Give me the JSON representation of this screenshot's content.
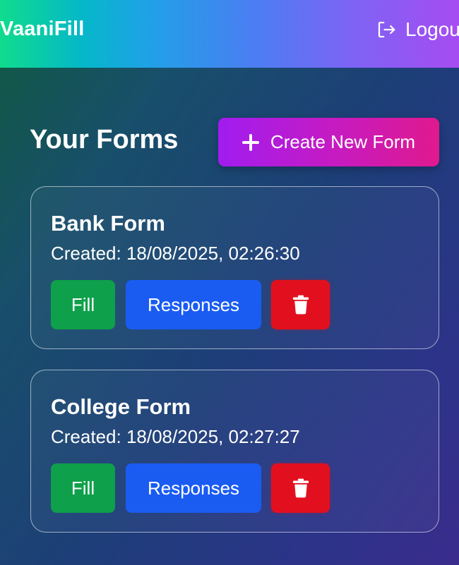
{
  "header": {
    "brand": "VaaniFill",
    "logout_label": "Logout",
    "logout_icon": "logout-icon"
  },
  "main": {
    "title": "Your Forms",
    "create_button": {
      "label": "Create New Form",
      "icon": "plus-icon"
    },
    "forms": [
      {
        "title": "Bank Form",
        "created": "Created: 18/08/2025, 02:26:30",
        "fill_label": "Fill",
        "responses_label": "Responses",
        "delete_icon": "trash-icon"
      },
      {
        "title": "College Form",
        "created": "Created: 18/08/2025, 02:27:27",
        "fill_label": "Fill",
        "responses_label": "Responses",
        "delete_icon": "trash-icon"
      }
    ]
  },
  "colors": {
    "fill_button": "#0ea04a",
    "responses_button": "#1a5cf2",
    "delete_button": "#e2101f",
    "create_button_start": "#a11cf0",
    "create_button_end": "#e0198e"
  }
}
